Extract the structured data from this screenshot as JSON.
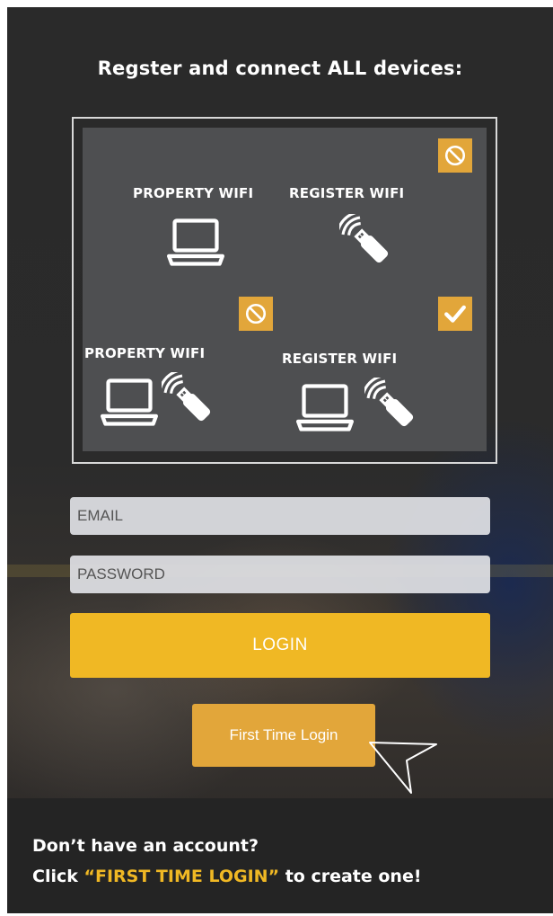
{
  "heading": "Regster and connect ALL devices:",
  "diagram": {
    "top_left_label": "PROPERTY WIFI",
    "top_right_label": "REGISTER WIFI",
    "bottom_left_label": "PROPERTY WIFI",
    "bottom_right_label": "REGISTER WIFI",
    "icons": {
      "top_left": "laptop-icon",
      "top_right": "usb-wifi-dongle-icon",
      "bottom_left": [
        "laptop-icon",
        "usb-wifi-dongle-icon"
      ],
      "bottom_right": [
        "laptop-icon",
        "usb-wifi-dongle-icon"
      ],
      "status_top": "prohibited-icon",
      "status_middle": "prohibited-icon",
      "status_bottom_right": "checkmark-icon"
    }
  },
  "form": {
    "email_placeholder": "EMAIL",
    "password_placeholder": "PASSWORD",
    "login_label": "LOGIN",
    "first_time_label": "First Time Login"
  },
  "note": {
    "line1": "Don’t have an account?",
    "line2_prefix": "Click ",
    "line2_highlight": "“FIRST TIME LOGIN”",
    "line2_suffix": " to create one!"
  },
  "colors": {
    "accent_yellow": "#f0b824",
    "badge_amber": "#e2a63a",
    "panel_gray": "#4e4f51",
    "band_dark": "#242424"
  }
}
